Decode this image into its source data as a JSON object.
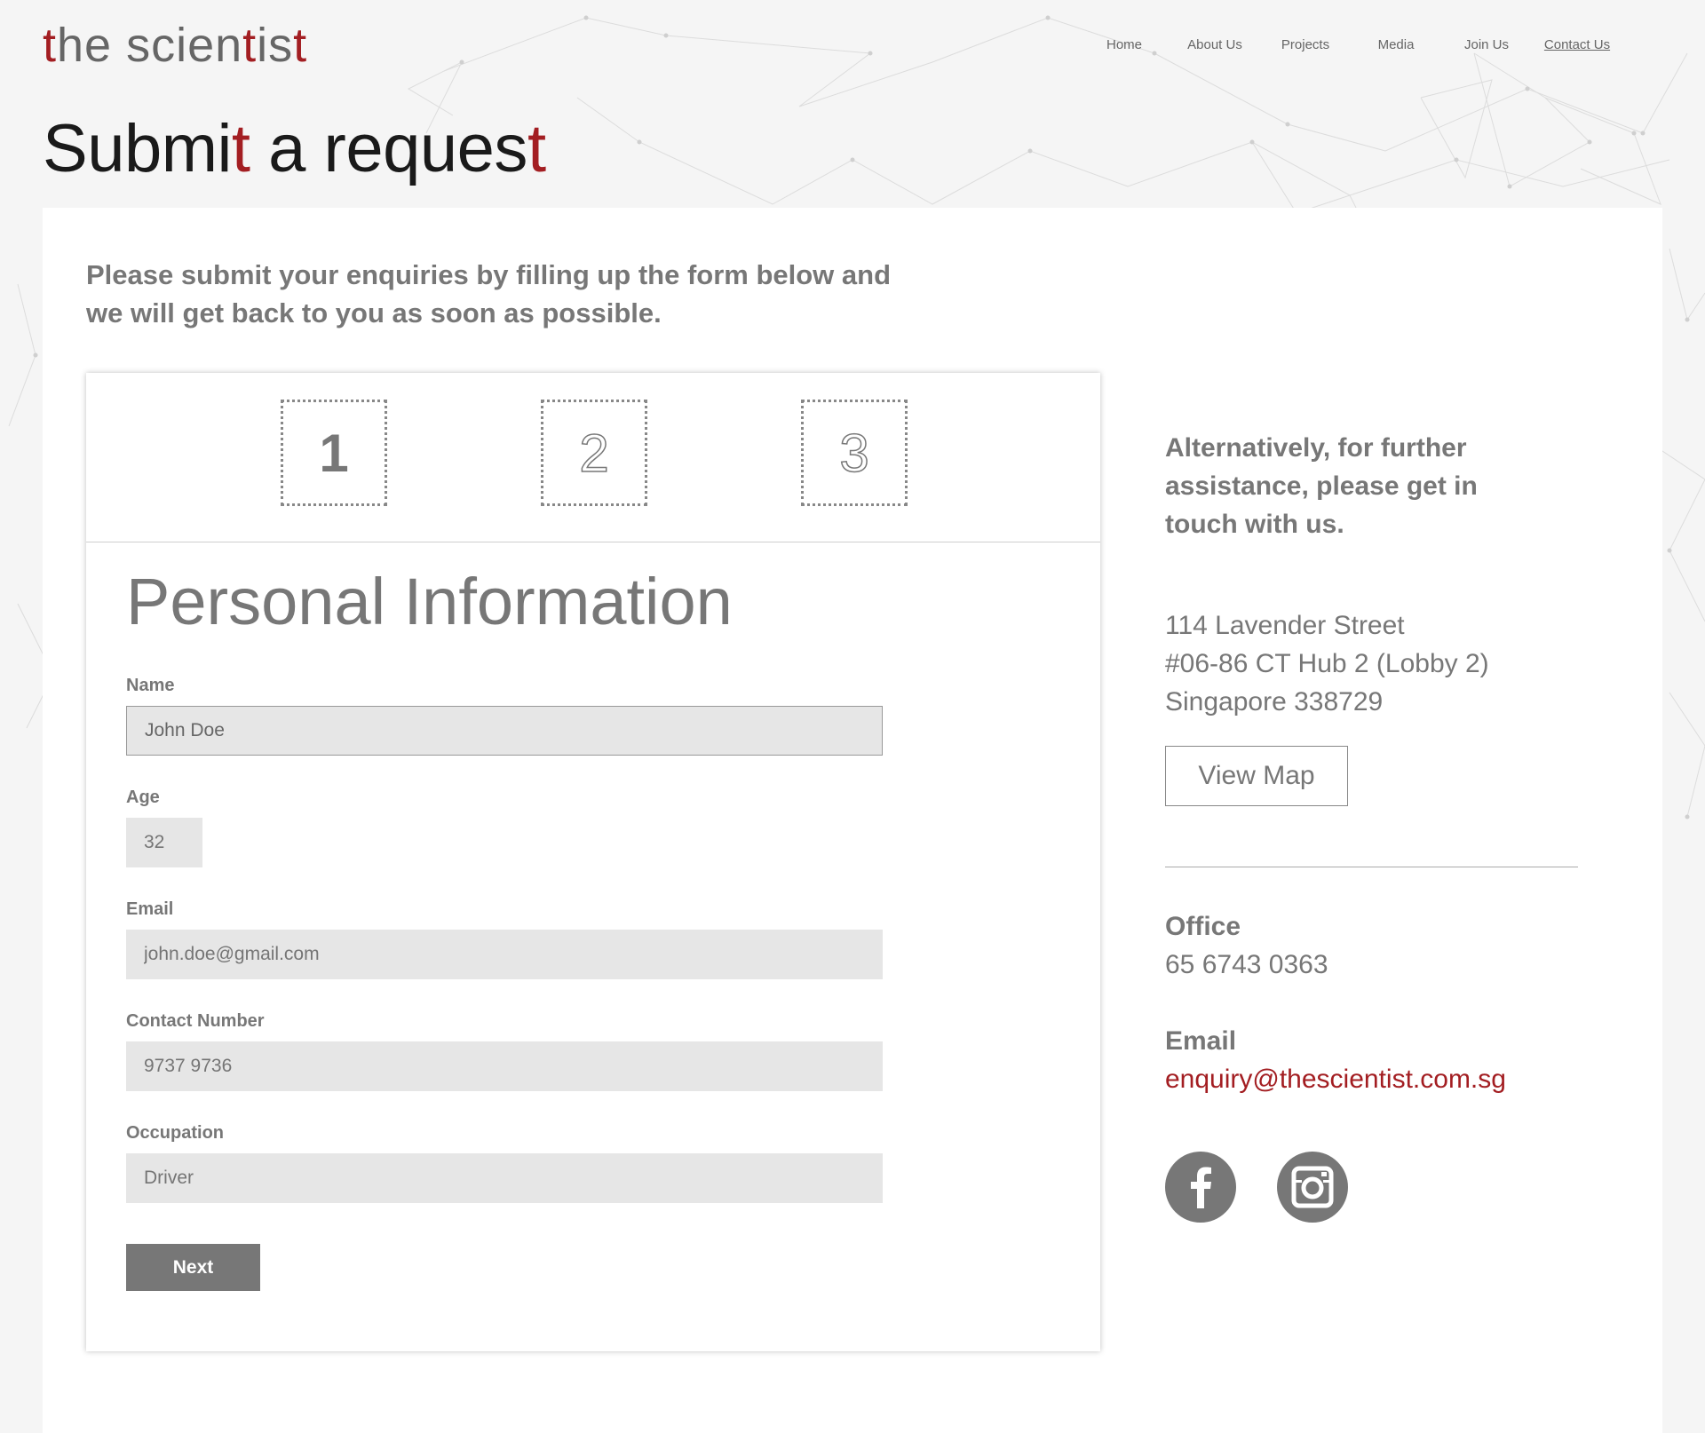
{
  "header": {
    "logo_parts": [
      "",
      "t",
      "he scien",
      "t",
      "is",
      "t"
    ],
    "nav": [
      {
        "label": "Home",
        "active": false
      },
      {
        "label": "About Us",
        "active": false
      },
      {
        "label": "Projects",
        "active": false
      },
      {
        "label": "Media",
        "active": false
      },
      {
        "label": "Join Us",
        "active": false
      },
      {
        "label": "Contact Us",
        "active": true
      }
    ]
  },
  "page": {
    "title_parts": [
      "Submi",
      "t",
      " a reques",
      "t"
    ]
  },
  "intro": {
    "line1": "Please submit your enquiries by filling up the form below and",
    "line2": "we will get back to you as soon as possible."
  },
  "form": {
    "steps": [
      {
        "label": "1",
        "current": true
      },
      {
        "label": "2",
        "current": false
      },
      {
        "label": "3",
        "current": false
      }
    ],
    "section_title": "Personal Information",
    "fields": {
      "name": {
        "label": "Name",
        "value": "John Doe"
      },
      "age": {
        "label": "Age",
        "placeholder": "32"
      },
      "email": {
        "label": "Email",
        "placeholder": "john.doe@gmail.com"
      },
      "contact": {
        "label": "Contact Number",
        "placeholder": "9737 9736"
      },
      "occupation": {
        "label": "Occupation",
        "placeholder": "Driver"
      }
    },
    "next_label": "Next"
  },
  "contact": {
    "alt_line1": "Alternatively, for further",
    "alt_line2": "assistance, please get in",
    "alt_line3": "touch with us.",
    "address": {
      "line1": "114 Lavender Street",
      "line2": "#06-86 CT Hub 2 (Lobby 2)",
      "line3": "Singapore 338729"
    },
    "view_map_label": "View Map",
    "office_label": "Office",
    "office_phone": "65 6743 0363",
    "email_label": "Email",
    "email": "enquiry@thescientist.com.sg",
    "social": [
      {
        "icon": "facebook-icon"
      },
      {
        "icon": "instagram-icon"
      }
    ]
  },
  "colors": {
    "accent_red": "#a31e22",
    "text_gray": "#777777",
    "input_bg": "#e6e6e6",
    "page_bg": "#f5f5f5"
  }
}
